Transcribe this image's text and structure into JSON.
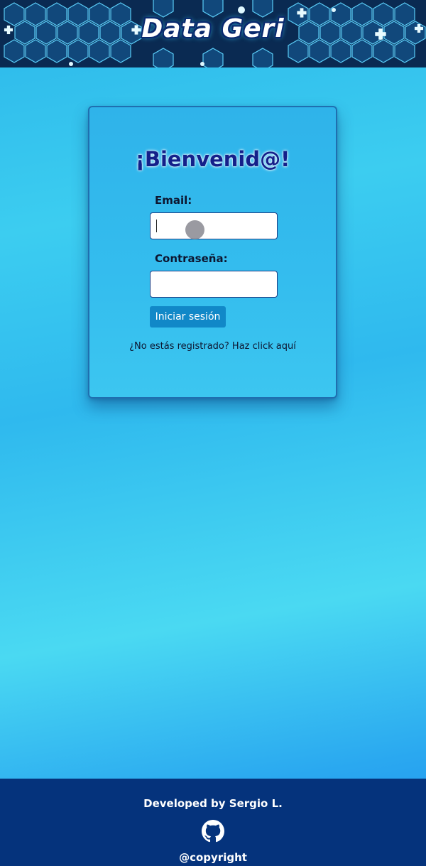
{
  "header": {
    "app_title": "Data Geri"
  },
  "login": {
    "heading": "¡Bienvenid@!",
    "email_label": "Email:",
    "email_value": "",
    "password_label": "Contraseña:",
    "password_value": "",
    "submit_label": "Iniciar sesión",
    "register_text": "¿No estás registrado? Haz click aquí"
  },
  "footer": {
    "credit": "Developed by Sergio L.",
    "github_icon": "github-icon",
    "copyright": "@copyright"
  },
  "colors": {
    "header_bg": "#07213f",
    "card_border": "#1f6fb0",
    "button_bg": "#1188c8",
    "heading_text": "#14208a",
    "footer_bg": "#05337c"
  }
}
